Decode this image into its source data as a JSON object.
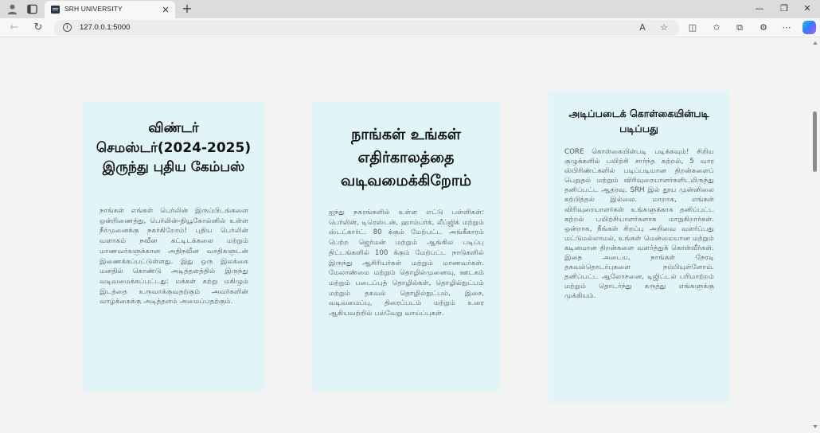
{
  "browser": {
    "tab": {
      "title": "SRH UNIVERSITY",
      "close_label": "×"
    },
    "new_tab_label": "+",
    "window_controls": {
      "minimize": "—",
      "maximize": "❐",
      "close": "✕"
    },
    "address_bar": {
      "url": "127.0.0.1:5000"
    },
    "icons": {
      "profile": "profile-icon",
      "tabs": "tabs-icon",
      "back": "back-arrow-icon",
      "reload": "reload-icon",
      "info": "info-icon",
      "read_aloud": "read-aloud-icon",
      "favorite": "star-icon",
      "split": "split-screen-icon",
      "favorites_list": "favorites-icon",
      "collections": "collections-icon",
      "extensions": "extensions-icon",
      "more": "more-icon",
      "copilot": "copilot-icon"
    }
  },
  "cards": [
    {
      "title": "விண்டர் செமஸ்டர்(2024-2025) இருந்து புதிய கேம்பஸ்",
      "body": "நாங்கள் எங்கள் பெர்லின் இருப்பிடங்களை ஒன்றிணைத்து, பெர்லின்-நியூகோல்னில் உள்ள நீர்முனைக்கு நகர்கிறோம்! புதிய பெர்லின் வளாகம் நவீன கட்டிடக்கலை மற்றும் மாணவர்களுக்கான அதிநவீன வசதிகளுடன் இணைக்கப்பட்டுள்ளது. இது ஒரு இலக்கை மனதில் கொண்டு அடித்தளத்தில் இருந்து வடிவமைக்கப்பட்டது: மக்கள் கற்று மகிழும் இடத்தை உருவாக்குவதற்கும் அவர்களின் வாழ்க்கைக்கு அடித்தளம் அமைப்பதற்கும்."
    },
    {
      "title": "நாங்கள் உங்கள் எதிர்காலத்தை வடிவமைக்கிறோம்",
      "body": "ஐந்து நகரங்களில் உள்ள எட்டு பள்ளிகள்: பெர்லின், டிரெஸ்டன், ஹாம்பர்க், லீப்ஜிக் மற்றும் ஸ்டட்கார்ட். 80 க்கும் மேற்பட்ட அங்கீகாரம் பெற்ற ஜெர்மன் மற்றும் ஆங்கில படிப்பு திட்டங்களில் 100 க்கும் மேற்பட்ட நாடுகளில் இருந்து ஆசிரியர்கள் மற்றும் மாணவர்கள். மேலாண்மை மற்றும் தொழில்முனைவு, ஊடகம் மற்றும் படைப்புத் தொழில்கள், தொழில்நுட்பம் மற்றும் தகவல் தொழில்நுட்பம், இசை, வடிவமைப்பு, திரைப்படம் மற்றும் உரை ஆகியவற்றில் பல்வேறு வாய்ப்புகள்."
    },
    {
      "title": "அடிப்படைக் கொள்கையின்படி படிப்பது",
      "body": "CORE கொள்கையின்படி படிக்கவும்! சிறிய குழுக்களில் பயிற்சி சார்ந்த கற்றல், 5 வார ஸ்பிரிண்ட்களில் படிப்படியான திறன்களைப் பெறுதல் மற்றும் விரிவுரையாளர்களிடமிருந்து தனிப்பட்ட ஆதரவு. SRH இல் தூய முன்னிலை கற்பித்தல் இல்லை. மாறாக, எங்கள் விரிவுரையாளர்கள் உங்களுக்காக தனிப்பட்ட கற்றல் பயிற்சியாளர்களாக மாறுகிறார்கள். ஒன்றாக, நீங்கள் சிறப்பு அறிவை வளர்ப்பது மட்டுமல்லாமல், உங்கள் மென்மையான மற்றும் கடினமான திறன்களை வளர்த்துக் கொள்வீர்கள். இதை அடைய, நாங்கள் நேரடி தகவல்தொடர்புகளை நம்பியுள்ளோம். தனிப்பட்ட ஆலோசனை, டிஜிட்டல் பரிமாற்றம் மற்றும் தொடர்ந்து கருத்து எங்களுக்கு முக்கியம்."
    }
  ]
}
